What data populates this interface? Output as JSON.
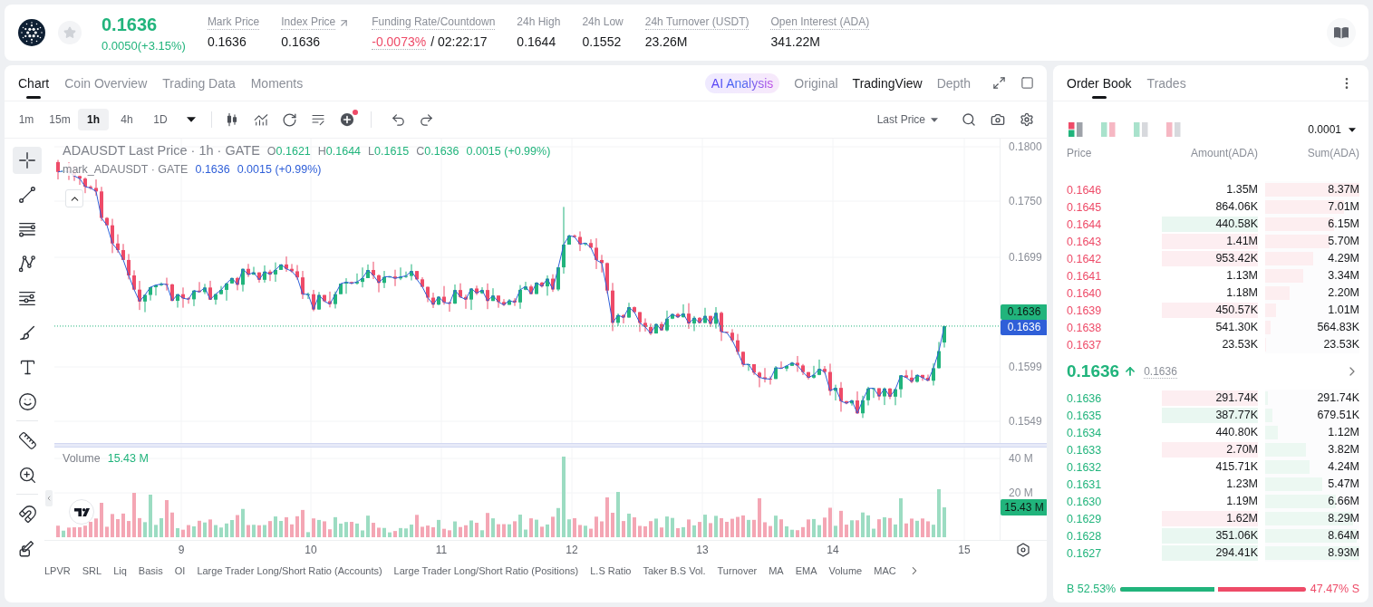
{
  "top_bar": {
    "price": "0.1636",
    "change": "0.0050(+3.15%)",
    "favorite": false,
    "stats": [
      {
        "kind": "plain",
        "label": "Mark Price",
        "value": "0.1636",
        "dotted": true
      },
      {
        "kind": "link",
        "label": "Index Price",
        "value": "0.1636",
        "dotted": true
      },
      {
        "kind": "funding",
        "label": "Funding Rate/Countdown",
        "value": "-0.0073%",
        "countdown": "/ 02:22:17",
        "dotted": true
      },
      {
        "kind": "plain",
        "label": "24h High",
        "value": "0.1644",
        "dotted": false
      },
      {
        "kind": "plain",
        "label": "24h Low",
        "value": "0.1552",
        "dotted": false
      },
      {
        "kind": "plain",
        "label": "24h Turnover (USDT)",
        "value": "23.26M",
        "dotted": true
      },
      {
        "kind": "plain",
        "label": "Open Interest (ADA)",
        "value": "341.22M",
        "dotted": true
      }
    ]
  },
  "chart_panel": {
    "tabs": [
      {
        "label": "Chart",
        "selected": true
      },
      {
        "label": "Coin Overview",
        "selected": false
      },
      {
        "label": "Trading Data",
        "selected": false
      },
      {
        "label": "Moments",
        "selected": false
      }
    ],
    "ai_button": {
      "label": "AI Analysis"
    },
    "views": [
      {
        "label": "Original",
        "selected": false
      },
      {
        "label": "TradingView",
        "selected": true
      },
      {
        "label": "Depth",
        "selected": false
      }
    ],
    "intervals": [
      {
        "label": "1m",
        "selected": false
      },
      {
        "label": "15m",
        "selected": false
      },
      {
        "label": "1h",
        "selected": true
      },
      {
        "label": "4h",
        "selected": false
      },
      {
        "label": "1D",
        "selected": false
      }
    ],
    "add_indicator_alert": true,
    "price_source": "Last Price",
    "tool_groups": [
      [
        {
          "kind": "crosshair",
          "selected": true
        },
        {
          "kind": "trend-line",
          "selected": false
        },
        {
          "kind": "horizontal-lines",
          "selected": false
        },
        {
          "kind": "pattern",
          "selected": false
        },
        {
          "kind": "fibonacci",
          "selected": false
        },
        {
          "kind": "brush",
          "selected": false
        },
        {
          "kind": "text",
          "selected": false
        },
        {
          "kind": "emoji",
          "selected": false
        }
      ],
      [
        {
          "kind": "ruler",
          "selected": false
        },
        {
          "kind": "zoom",
          "selected": false
        }
      ],
      [
        {
          "kind": "magnet",
          "selected": false
        },
        {
          "kind": "lock-drawing",
          "selected": false
        }
      ]
    ],
    "legend": {
      "title": "ADAUSDT Last Price · 1h · GATE",
      "ohlc": [
        {
          "key": "O",
          "value": "0.1621"
        },
        {
          "key": "H",
          "value": "0.1644"
        },
        {
          "key": "L",
          "value": "0.1615"
        },
        {
          "key": "C",
          "value": "0.1636"
        }
      ],
      "change": "0.0015 (+0.99%)"
    },
    "mark_legend": {
      "title": "mark_ADAUSDT · GATE",
      "value": "0.1636",
      "change": "0.0015 (+0.99%)"
    },
    "price_axis": [
      "0.1800",
      "0.1750",
      "0.1699",
      "0.1599",
      "0.1549"
    ],
    "price_tags": [
      {
        "label": "0.1636",
        "kind": "last"
      },
      {
        "label": "0.1636",
        "kind": "mark"
      }
    ],
    "volume_legend": {
      "title": "Volume",
      "value": "15.43 M"
    },
    "volume_axis": [
      "40 M",
      "20 M"
    ],
    "volume_tag": "15.43 M",
    "time_axis": [
      "9",
      "10",
      "11",
      "12",
      "13",
      "14",
      "15"
    ],
    "indicators": [
      "LPVR",
      "SRL",
      "Liq",
      "Basis",
      "OI",
      "Large Trader Long/Short Ratio (Accounts)",
      "Large Trader Long/Short Ratio (Positions)",
      "L.S Ratio",
      "Taker B.S Vol.",
      "Turnover",
      "MA",
      "EMA",
      "Volume",
      "MAC"
    ]
  },
  "order_book": {
    "tabs": [
      {
        "label": "Order Book",
        "selected": true
      },
      {
        "label": "Trades",
        "selected": false
      }
    ],
    "layouts": [
      {
        "kind": "split",
        "selected": true
      },
      {
        "kind": "side-by-side",
        "selected": false
      },
      {
        "kind": "bids",
        "selected": false
      },
      {
        "kind": "asks",
        "selected": false
      }
    ],
    "precision": "0.0001",
    "columns": [
      "Price",
      "Amount(ADA)",
      "Sum(ADA)"
    ],
    "asks": [
      {
        "price": "0.1646",
        "amount": "1.35M",
        "sum": "8.37M",
        "level": 1.0,
        "color": "#ffffff"
      },
      {
        "price": "0.1645",
        "amount": "864.06K",
        "sum": "7.01M",
        "level": 0.84,
        "color": "#ffffff"
      },
      {
        "price": "0.1644",
        "amount": "440.58K",
        "sum": "6.15M",
        "level": 0.73,
        "color": "#e9f7f1"
      },
      {
        "price": "0.1643",
        "amount": "1.41M",
        "sum": "5.70M",
        "level": 0.68,
        "color": "#fdeef1"
      },
      {
        "price": "0.1642",
        "amount": "953.42K",
        "sum": "4.29M",
        "level": 0.51,
        "color": "#fdeef1"
      },
      {
        "price": "0.1641",
        "amount": "1.13M",
        "sum": "3.34M",
        "level": 0.4,
        "color": "#ffffff"
      },
      {
        "price": "0.1640",
        "amount": "1.18M",
        "sum": "2.20M",
        "level": 0.26,
        "color": "#ffffff"
      },
      {
        "price": "0.1639",
        "amount": "450.57K",
        "sum": "1.01M",
        "level": 0.12,
        "color": "#fdeef1"
      },
      {
        "price": "0.1638",
        "amount": "541.30K",
        "sum": "564.83K",
        "level": 0.06,
        "color": "#ffffff"
      },
      {
        "price": "0.1637",
        "amount": "23.53K",
        "sum": "23.53K",
        "level": 0.003,
        "color": "#ffffff"
      }
    ],
    "mid": {
      "price": "0.1636",
      "mark": "0.1636"
    },
    "bids": [
      {
        "price": "0.1636",
        "amount": "291.74K",
        "sum": "291.74K",
        "level": 0.03,
        "color": "#fdeef1"
      },
      {
        "price": "0.1635",
        "amount": "387.77K",
        "sum": "679.51K",
        "level": 0.08,
        "color": "#e9f7f1"
      },
      {
        "price": "0.1634",
        "amount": "440.80K",
        "sum": "1.12M",
        "level": 0.13,
        "color": "#ffffff"
      },
      {
        "price": "0.1633",
        "amount": "2.70M",
        "sum": "3.82M",
        "level": 0.43,
        "color": "#fdeef1"
      },
      {
        "price": "0.1632",
        "amount": "415.71K",
        "sum": "4.24M",
        "level": 0.47,
        "color": "#ffffff"
      },
      {
        "price": "0.1631",
        "amount": "1.23M",
        "sum": "5.47M",
        "level": 0.61,
        "color": "#ffffff"
      },
      {
        "price": "0.1630",
        "amount": "1.19M",
        "sum": "6.66M",
        "level": 0.75,
        "color": "#ffffff"
      },
      {
        "price": "0.1629",
        "amount": "1.62M",
        "sum": "8.29M",
        "level": 0.93,
        "color": "#fdeef1"
      },
      {
        "price": "0.1628",
        "amount": "351.06K",
        "sum": "8.64M",
        "level": 0.97,
        "color": "#e9f7f1"
      },
      {
        "price": "0.1627",
        "amount": "294.41K",
        "sum": "8.93M",
        "level": 1.0,
        "color": "#e9f7f1"
      }
    ],
    "ratio": {
      "buy": "B 52.53%",
      "sell": "47.47% S",
      "level": 0.5253
    }
  }
}
